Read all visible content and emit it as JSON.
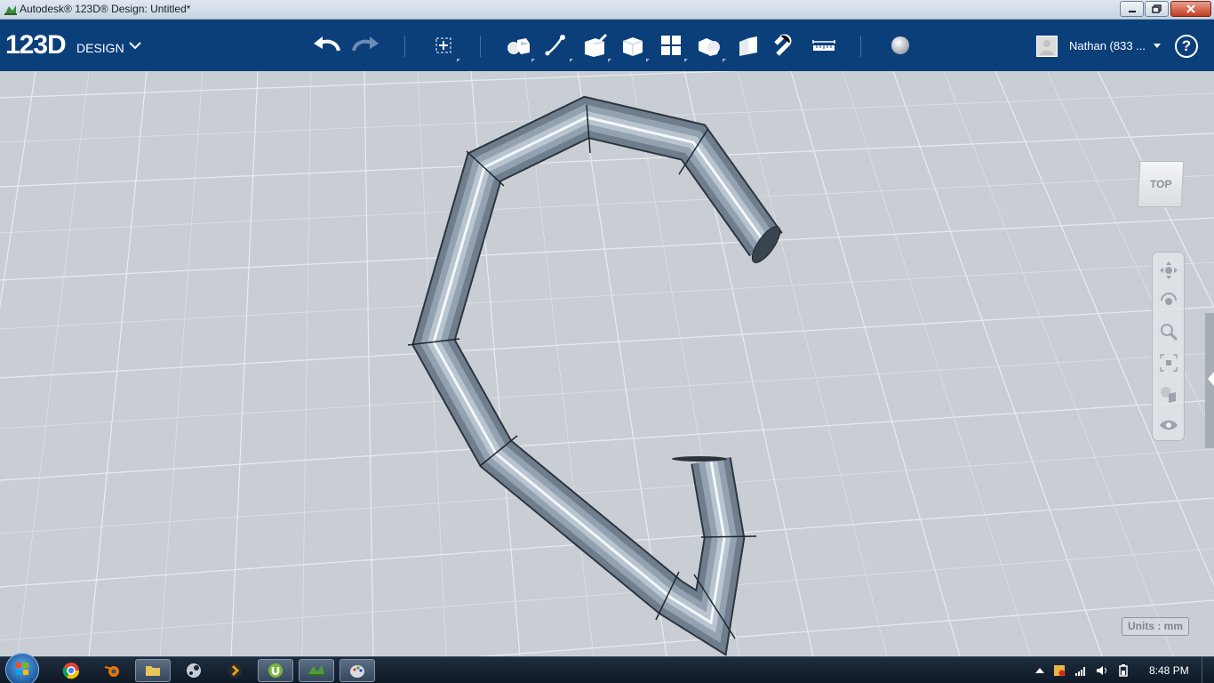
{
  "window": {
    "title": "Autodesk® 123D® Design: Untitled*"
  },
  "toolbar": {
    "logo_main": "123D",
    "logo_sub": "DESIGN",
    "user_name": "Nathan  (833 ..."
  },
  "viewport": {
    "viewcube_label": "TOP",
    "units_label": "Units : mm"
  },
  "taskbar": {
    "clock": "8:48 PM"
  },
  "colors": {
    "toolbar_bg": "#0b3f7a",
    "viewport_bg": "#c9ced4",
    "pipe": "#8a97a6"
  }
}
